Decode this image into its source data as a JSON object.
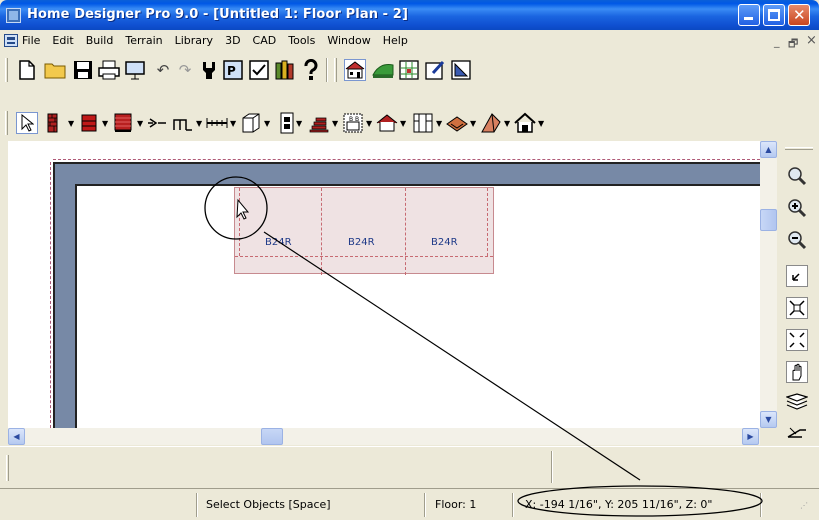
{
  "window": {
    "title": "Home Designer Pro 9.0 - [Untitled 1: Floor Plan - 2]"
  },
  "menubar": {
    "items": [
      "File",
      "Edit",
      "Build",
      "Terrain",
      "Library",
      "3D",
      "CAD",
      "Tools",
      "Window",
      "Help"
    ],
    "mdi_minimize": "_",
    "mdi_restore": "🗗",
    "mdi_close": "×"
  },
  "toolbar1": {
    "icons": [
      "new-document-icon",
      "open-folder-icon",
      "save-icon",
      "print-icon",
      "print-preview-icon",
      "undo-icon",
      "redo-icon",
      "fill-window-icon",
      "select-objects-icon",
      "checklist-icon",
      "library-icon",
      "help-icon",
      "floor-plan-icon",
      "camera-icon",
      "elevation-icon",
      "edit-icon",
      "dimension-icon"
    ]
  },
  "toolbar2": {
    "icons": [
      "select-arrow-icon",
      "wall-tool-icon",
      "cabinet-tool-icon",
      "window-tool-icon",
      "door-tool-icon",
      "stair-tool-icon",
      "dimension-line-icon",
      "box-tool-icon",
      "layer-icon",
      "stairs-icon",
      "fixture-icon",
      "roof-icon",
      "shelf-icon",
      "slab-icon",
      "arch-icon",
      "house-icon"
    ]
  },
  "floorplan": {
    "cabinets": [
      "B24R",
      "B24R",
      "B24R"
    ]
  },
  "righttools": {
    "icons": [
      "zoom-icon",
      "zoom-in-icon",
      "zoom-out-icon",
      "zoom-box-icon",
      "fill-window-icon",
      "fill-all-icon",
      "pan-icon",
      "layers-icon",
      "tool-palette-icon"
    ]
  },
  "status": {
    "mode": "Select Objects [Space]",
    "floor": "Floor: 1",
    "coords": "X: -194 1/16\", Y: 205 11/16\", Z: 0\""
  },
  "colors": {
    "titlebar": "#0b56e0",
    "wall": "#7789a6",
    "cabinet_fill": "#efe2e3",
    "cabinet_label": "#1f3a88"
  }
}
